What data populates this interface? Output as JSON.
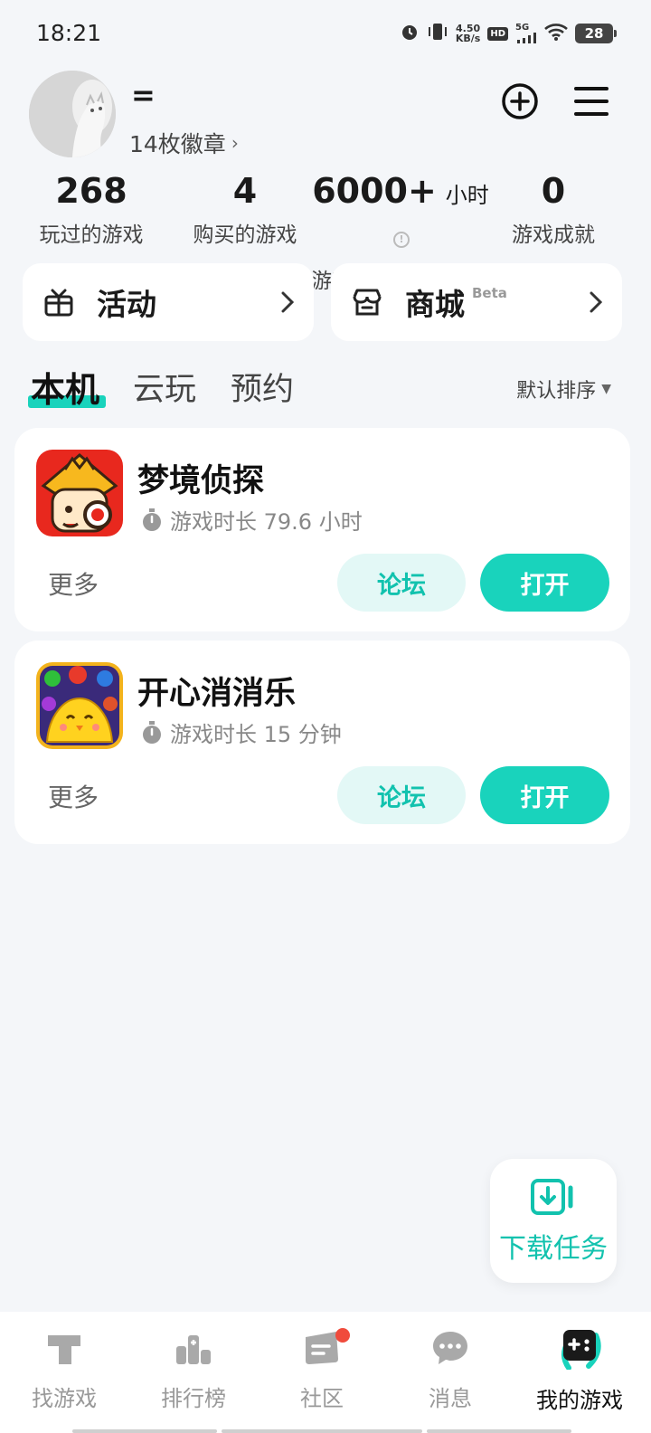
{
  "status_bar": {
    "time": "18:21",
    "net_speed_value": "4.50",
    "net_speed_unit": "KB/s",
    "hd": "HD",
    "network": "5G",
    "battery": "28"
  },
  "profile": {
    "username": "=",
    "badges": "14枚徽章"
  },
  "stats": [
    {
      "value": "268",
      "label": "玩过的游戏"
    },
    {
      "value": "4",
      "label": "购买的游戏"
    },
    {
      "value": "6000+",
      "unit": "小时",
      "label": "游戏时长"
    },
    {
      "value": "0",
      "label": "游戏成就"
    }
  ],
  "shortcuts": {
    "activity": "活动",
    "store": "商城",
    "store_badge": "Beta"
  },
  "tabs": [
    {
      "label": "本机",
      "active": true
    },
    {
      "label": "云玩",
      "active": false
    },
    {
      "label": "预约",
      "active": false
    }
  ],
  "sort": {
    "label": "默认排序"
  },
  "games": [
    {
      "name": "梦境侦探",
      "playtime": "游戏时长 79.6 小时",
      "more": "更多",
      "forum": "论坛",
      "open": "打开"
    },
    {
      "name": "开心消消乐",
      "playtime": "游戏时长 15 分钟",
      "more": "更多",
      "forum": "论坛",
      "open": "打开"
    }
  ],
  "download_task": {
    "label": "下载任务"
  },
  "bottom_nav": [
    {
      "label": "找游戏",
      "icon": "find-game-icon"
    },
    {
      "label": "排行榜",
      "icon": "leaderboard-icon"
    },
    {
      "label": "社区",
      "icon": "community-icon",
      "badge": true
    },
    {
      "label": "消息",
      "icon": "message-icon"
    },
    {
      "label": "我的游戏",
      "icon": "my-games-icon",
      "active": true
    }
  ],
  "colors": {
    "accent": "#19d3bc",
    "accent_text": "#12c2ae",
    "forum_bg": "#e3f8f6",
    "background": "#f4f6f9",
    "notification": "#f04b3c"
  }
}
